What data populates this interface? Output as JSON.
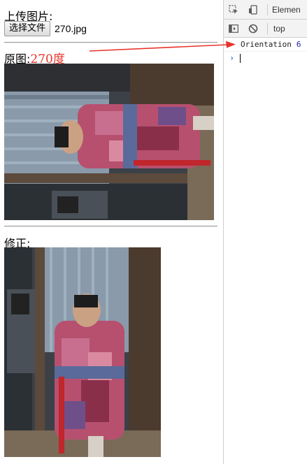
{
  "page": {
    "upload_label": "上传图片:",
    "file_button_label": "选择文件",
    "file_name": "270.jpg",
    "original_label": "原图:",
    "original_angle": "270度",
    "fixed_label": "修正:",
    "accent_color": "#e8332a"
  },
  "devtools": {
    "tab_elements": "Elemen",
    "context": "top",
    "log": {
      "key": "Orientation",
      "value": "6"
    },
    "prompt": "›",
    "icons": [
      "inspect-icon",
      "device-toggle-icon",
      "sidebar-toggle-icon",
      "clear-console-icon"
    ]
  }
}
